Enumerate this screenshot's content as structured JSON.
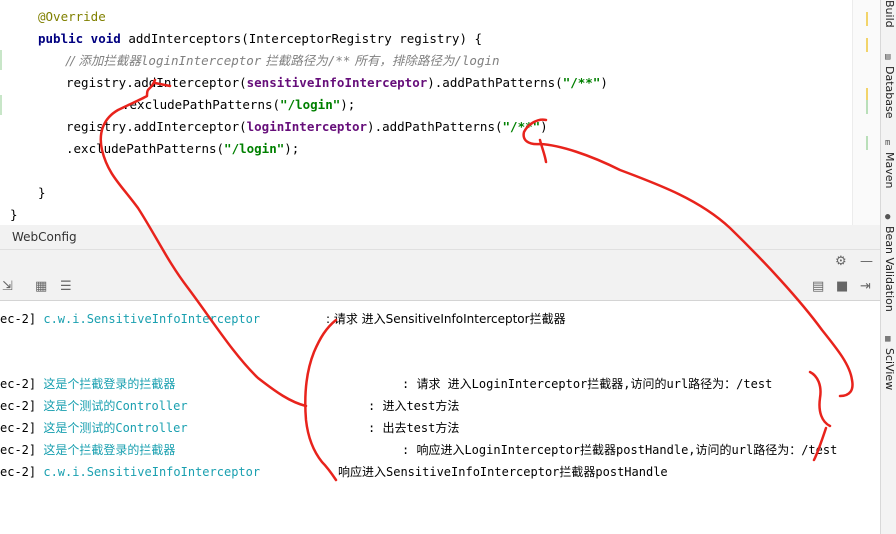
{
  "editor": {
    "lines": {
      "override": "@Override",
      "sig_kw": "public void",
      "sig_rest": " addInterceptors(InterceptorRegistry registry) {",
      "comment_prefix": "// 添加拦截器",
      "comment_italic1": "loginInterceptor",
      "comment_mid": " 拦截路径为",
      "comment_italic2": "/**",
      "comment_mid2": " 所有，排除路径为",
      "comment_italic3": "/login",
      "l4_a": "registry.addInterceptor(",
      "l4_field": "sensitiveInfoInterceptor",
      "l4_b": ").addPathPatterns(",
      "l4_str": "\"/**\"",
      "l4_c": ")",
      "l5_a": ".excludePathPatterns(",
      "l5_str": "\"/login\"",
      "l5_b": ");",
      "l6_a": "registry.addInterceptor(",
      "l6_field": "loginInterceptor",
      "l6_b": ").addPathPatterns(",
      "l6_str": "\"/**\"",
      "l6_c": ")",
      "l7_a": ".excludePathPatterns(",
      "l7_str": "\"/login\"",
      "l7_b": ");",
      "close1": "}",
      "close2": "}"
    }
  },
  "tab": {
    "label": "WebConfig"
  },
  "right_strip": {
    "build": "Build",
    "database": "Database",
    "maven": "Maven",
    "bean_validation": "Bean Validation",
    "sciview": "SciView"
  },
  "console": {
    "rows": [
      {
        "prefix": "ec-2]",
        "source": "c.w.i.SensitiveInfoInterceptor",
        "message": ": 请求 进入SensitiveInfoInterceptor拦截器"
      },
      {
        "prefix": "ec-2]",
        "source": "这是个拦截登录的拦截器",
        "message": ": 请求 进入LoginInterceptor拦截器,访问的url路径为：/test"
      },
      {
        "prefix": "ec-2]",
        "source": "这是个测试的Controller",
        "message": ": 进入test方法"
      },
      {
        "prefix": "ec-2]",
        "source": "这是个测试的Controller",
        "message": ": 出去test方法"
      },
      {
        "prefix": "ec-2]",
        "source": "这是个拦截登录的拦截器",
        "message": ": 响应进入LoginInterceptor拦截器postHandle,访问的url路径为：/test"
      },
      {
        "prefix": "ec-2]",
        "source": "c.w.i.SensitiveInfoInterceptor",
        "message": "响应进入SensitiveInfoInterceptor拦截器postHandle"
      }
    ]
  },
  "colors": {
    "keyword": "#000080",
    "annotation": "#808000",
    "string": "#008000",
    "field": "#660e7a",
    "log_source": "#1aa0b0",
    "red_annotation": "#e8231c"
  },
  "icons": [
    "gear-icon",
    "minimize-icon",
    "scroll-to-end-icon",
    "print-icon",
    "clear-icon",
    "layout-icon",
    "filter-icon"
  ]
}
